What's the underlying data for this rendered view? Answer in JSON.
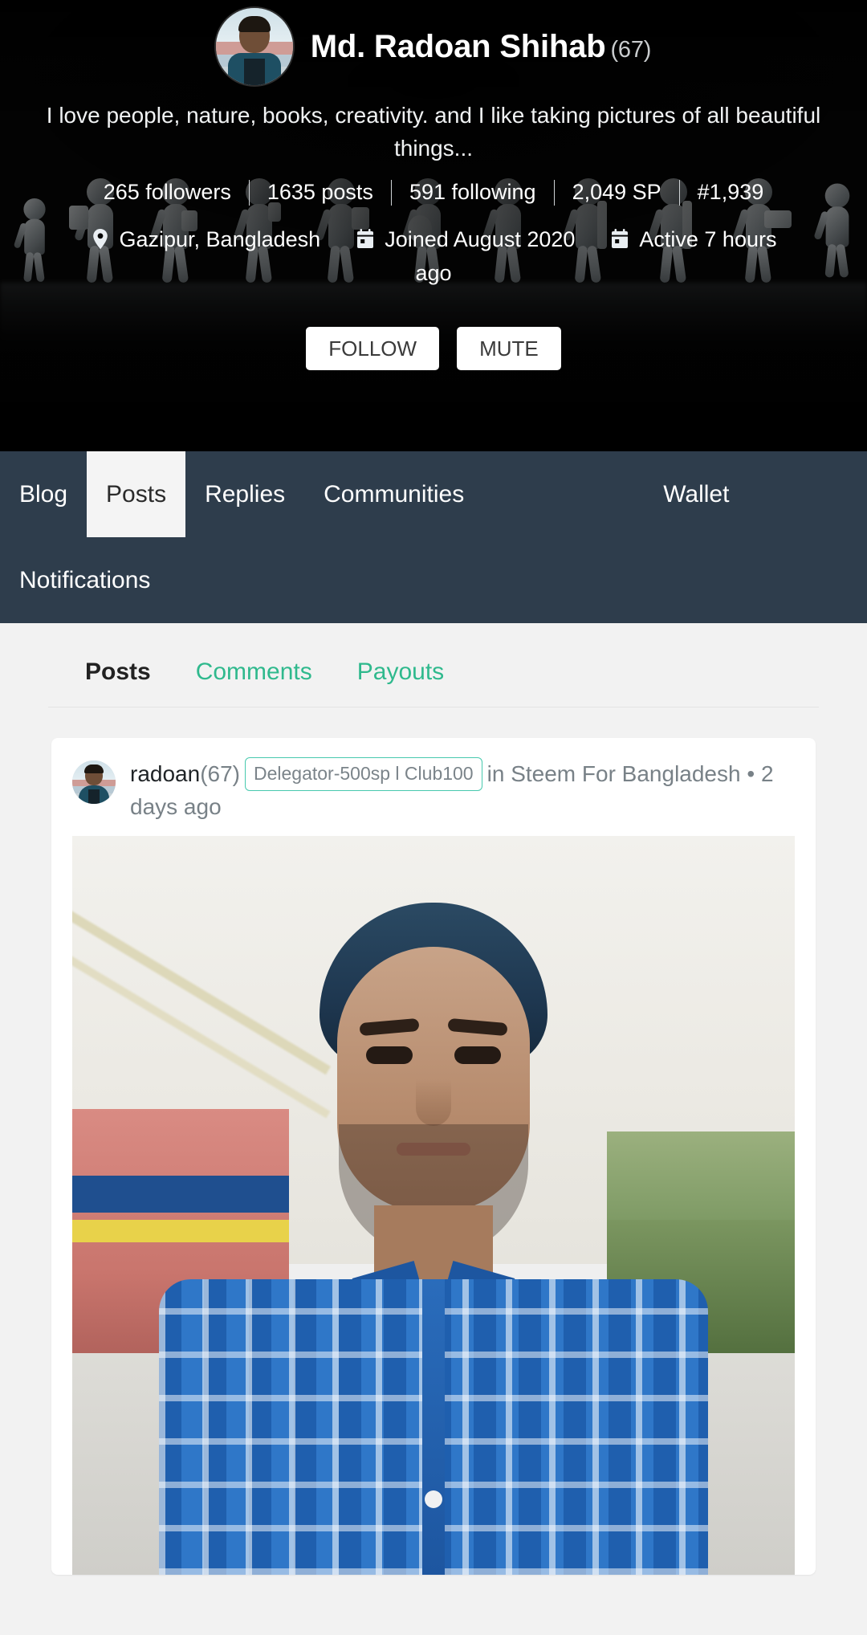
{
  "profile": {
    "name": "Md. Radoan Shihab",
    "reputation": "(67)",
    "about": "I love people, nature, books, creativity. and I like taking pictures of all beautiful things...",
    "avatar_icon": "user-avatar",
    "stats": [
      {
        "label": "265 followers"
      },
      {
        "label": "1635 posts"
      },
      {
        "label": "591 following"
      },
      {
        "label": "2,049 SP"
      },
      {
        "label": "#1,939"
      }
    ],
    "meta": {
      "location_icon": "map-pin-icon",
      "location": "Gazipur, Bangladesh",
      "joined_icon": "calendar-icon",
      "joined": "Joined August 2020",
      "active_icon": "calendar-icon",
      "active": "Active 7 hours",
      "active_tail": "ago"
    },
    "actions": {
      "follow": "FOLLOW",
      "mute": "MUTE"
    }
  },
  "nav": {
    "items": [
      {
        "label": "Blog",
        "active": false
      },
      {
        "label": "Posts",
        "active": true
      },
      {
        "label": "Replies",
        "active": false
      },
      {
        "label": "Communities",
        "active": false
      },
      {
        "label": "Wallet",
        "active": false
      },
      {
        "label": "Notifications",
        "active": false
      }
    ]
  },
  "subtabs": [
    {
      "label": "Posts",
      "active": true
    },
    {
      "label": "Comments",
      "active": false
    },
    {
      "label": "Payouts",
      "active": false
    }
  ],
  "post": {
    "avatar_icon": "user-avatar",
    "author": "radoan",
    "reputation": "(67)",
    "badge": "Delegator-500sp l Club100",
    "community_prefix": "in",
    "community": "Steem For Bangladesh",
    "separator": "•",
    "age": "2 days ago",
    "image_alt": "post-photo"
  },
  "colors": {
    "header_bg": "#060606",
    "nav_bg": "#2e3d4c",
    "nav_active_bg": "#f4f4f4",
    "accent_green": "#2fb98d",
    "badge_border": "#48c9ae",
    "page_bg": "#f2f2f2",
    "card_bg": "#ffffff"
  }
}
